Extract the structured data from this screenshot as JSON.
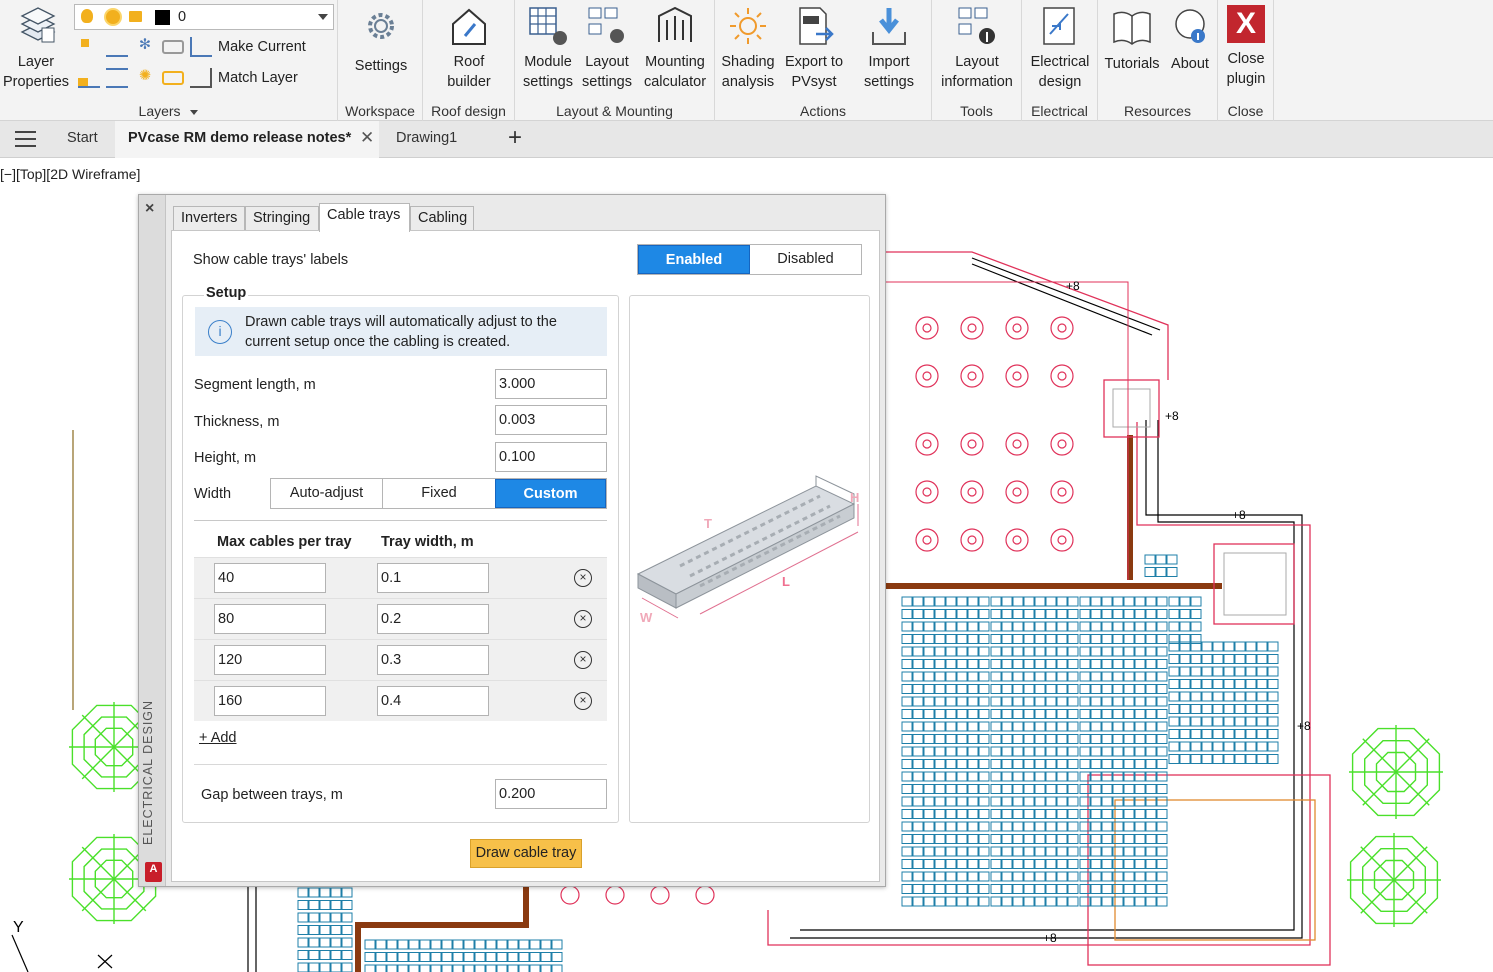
{
  "ribbon": {
    "layers": {
      "layer_properties_label": "Layer\nProperties",
      "current_layer": "0",
      "make_current": "Make Current",
      "match_layer": "Match Layer",
      "panel_title": "Layers"
    },
    "workspace": {
      "settings": "Settings",
      "panel_title": "Workspace"
    },
    "roof_design": {
      "roof_builder": "Roof\nbuilder",
      "panel_title": "Roof design"
    },
    "layout_mounting": {
      "module_settings": "Module\nsettings",
      "layout_settings": "Layout\nsettings",
      "mounting_calculator": "Mounting\ncalculator",
      "panel_title": "Layout & Mounting"
    },
    "actions": {
      "shading_analysis": "Shading\nanalysis",
      "export_pvsyst": "Export to\nPVsyst",
      "import_settings": "Import\nsettings",
      "panel_title": "Actions"
    },
    "tools": {
      "layout_information": "Layout\ninformation",
      "panel_title": "Tools"
    },
    "electrical": {
      "electrical_design": "Electrical\ndesign",
      "panel_title": "Electrical"
    },
    "resources": {
      "tutorials": "Tutorials",
      "about": "About",
      "panel_title": "Resources"
    },
    "close": {
      "close_plugin": "Close\nplugin",
      "panel_title": "Close"
    }
  },
  "doc_tabs": {
    "start": "Start",
    "active": "PVcase RM demo release notes*",
    "drawing1": "Drawing1",
    "add": "+"
  },
  "viewport": {
    "label": "[−][Top][2D Wireframe]",
    "tray_labels": [
      "+8",
      "+8",
      "+8",
      "+8",
      "+8"
    ],
    "axis_y": "Y"
  },
  "palette": {
    "close": "×",
    "side_title": "ELECTRICAL DESIGN",
    "logo": "A",
    "tabs": [
      "Inverters",
      "Stringing",
      "Cable trays",
      "Cabling"
    ],
    "active_tab": "Cable trays",
    "show_labels": {
      "label": "Show cable trays' labels",
      "options": [
        "Enabled",
        "Disabled"
      ],
      "selected": "Enabled"
    },
    "setup": {
      "title": "Setup",
      "info": "Drawn cable trays will automatically adjust to the current setup once the cabling is created.",
      "segment_length_label": "Segment length, m",
      "segment_length": "3.000",
      "thickness_label": "Thickness, m",
      "thickness": "0.003",
      "height_label": "Height, m",
      "height": "0.100",
      "width_label": "Width",
      "width_options": [
        "Auto-adjust",
        "Fixed",
        "Custom"
      ],
      "width_selected": "Custom",
      "table_headers": [
        "Max cables per tray",
        "Tray width, m"
      ],
      "rows": [
        {
          "max_cables": "40",
          "tray_width": "0.1"
        },
        {
          "max_cables": "80",
          "tray_width": "0.2"
        },
        {
          "max_cables": "120",
          "tray_width": "0.3"
        },
        {
          "max_cables": "160",
          "tray_width": "0.4"
        }
      ],
      "add_label": "+ Add",
      "gap_label": "Gap between trays, m",
      "gap": "0.200"
    },
    "diagram_labels": {
      "h": "H",
      "t": "T",
      "l": "L",
      "w": "W"
    },
    "draw_button": "Draw cable tray"
  }
}
